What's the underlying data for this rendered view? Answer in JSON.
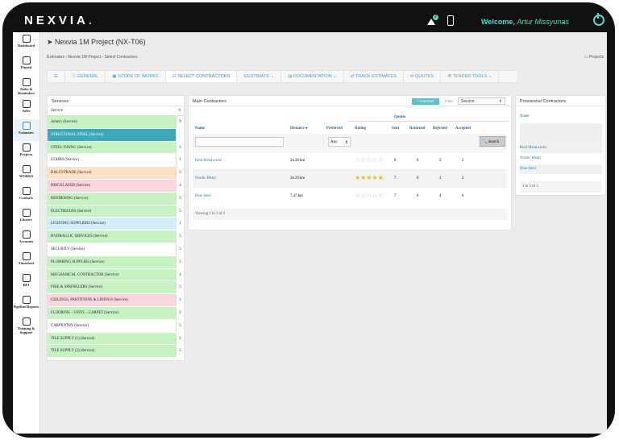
{
  "app": {
    "logo": "NEXVIA",
    "logo_suffix": ".",
    "welcome_prefix": "Welcome,",
    "user": "Artur Missyunas",
    "notif_count": "2"
  },
  "nav": [
    {
      "label": "Dashboard"
    },
    {
      "label": "Pinned"
    },
    {
      "label": "Tasks & Reminders"
    },
    {
      "label": "Sales"
    },
    {
      "label": "Estimates"
    },
    {
      "label": "Projects"
    },
    {
      "label": "WORKS"
    },
    {
      "label": "Contacts"
    },
    {
      "label": "Library"
    },
    {
      "label": "Accounts"
    },
    {
      "label": "Timesheet"
    },
    {
      "label": "RFI"
    },
    {
      "label": "Pipeline Reports"
    },
    {
      "label": "Training & Support"
    }
  ],
  "page": {
    "title": "Nexvia 1M Project (NX-T06)",
    "breadcrumb": [
      "Estimates",
      "Nexvia 1M Project",
      "Select Contractors"
    ],
    "projects_link": "Projects"
  },
  "tabs": [
    "GENERAL",
    "SCOPE OF WORKS",
    "SELECT CONTRACTORS",
    "ESTIMATE",
    "DOCUMENTATION",
    "TRACK ESTIMATES",
    "QUOTES",
    "TENDER TOOLS"
  ],
  "services": {
    "title": "Services",
    "col_header": "Service",
    "rows": [
      {
        "name": "Joinery (Service)",
        "count": "9",
        "color": "#c9f2c4"
      },
      {
        "name": "STRUCTURAL STEEL (Service)",
        "count": "3",
        "color": "#3fa8b4"
      },
      {
        "name": "STEEL FIXING (Service)",
        "count": "3",
        "color": "#c9f2c4"
      },
      {
        "name": "STAIRS (Service)",
        "count": "1",
        "color": "#ffffff"
      },
      {
        "name": "BALUSTRADE (Service)",
        "count": "3",
        "color": "#fde1c8"
      },
      {
        "name": "BRICKLAYER (Service)",
        "count": "4",
        "color": "#fbd6dc"
      },
      {
        "name": "RENDERING (Service)",
        "count": "3",
        "color": "#c9f2c4"
      },
      {
        "name": "ELECTRICIAN (Service)",
        "count": "5",
        "color": "#c9f2c4"
      },
      {
        "name": "LIGHTING SUPPLIERS (Service)",
        "count": "1",
        "color": "#d3eefa"
      },
      {
        "name": "HYDRAULIC SERVICES (Service)",
        "count": "3",
        "color": "#c9f2c4"
      },
      {
        "name": "SECURITY (Service)",
        "count": "5",
        "color": "#ffffff"
      },
      {
        "name": "PLUMBING SUPPLIES (Service)",
        "count": "3",
        "color": "#c9f2c4"
      },
      {
        "name": "MECHANICAL CONTRACTOR (Service)",
        "count": "4",
        "color": "#c9f2c4"
      },
      {
        "name": "FIRE & SPRINKLERS (Service)",
        "count": "5",
        "color": "#c9f2c4"
      },
      {
        "name": "CEILINGS, PARTITIONS & LININGS (Service)",
        "count": "3",
        "color": "#fbd6dc"
      },
      {
        "name": "FLOORING - VINYL - CARPET (Service)",
        "count": "3",
        "color": "#c9f2c4"
      },
      {
        "name": "CARPENTRY (Service)",
        "count": "5",
        "color": "#ffffff"
      },
      {
        "name": "TILE SUPPLY (1) (Service)",
        "count": "3",
        "color": "#c9f2c4"
      },
      {
        "name": "TILE SUPPLY (2) (Service)",
        "count": "3",
        "color": "#c9f2c4"
      }
    ]
  },
  "main": {
    "title": "Main Contractors",
    "contract_btn": "+ Contract",
    "filter_label": "Filter:",
    "filter_value": "Service",
    "quotes_group": "Quotes",
    "headers": {
      "name": "Name",
      "distance": "Distance",
      "preferred": "Preferred",
      "rating": "Rating",
      "sent": "Sent",
      "returned": "Returned",
      "rejected": "Rejected",
      "accepted": "Accepted"
    },
    "preferred_filter": "Any",
    "search_btn": "Search",
    "rows": [
      {
        "name": "Reid Metalworks",
        "distance": "24.28 km",
        "rating": 0,
        "sent": "6",
        "returned": "6",
        "rejected": "2",
        "accepted": "2"
      },
      {
        "name": "Nordic Metal",
        "distance": "34.29 km",
        "rating": 5,
        "sent": "7",
        "returned": "6",
        "rejected": "3",
        "accepted": "2"
      },
      {
        "name": "Blue Steel",
        "distance": "7.47 km",
        "rating": 0,
        "sent": "7",
        "returned": "6",
        "rejected": "4",
        "accepted": "0"
      }
    ],
    "footer": "Viewing 1 to 3 of 3"
  },
  "provisional": {
    "title": "Provisional Contractors",
    "col_header": "Name",
    "items": [
      "Reid Metalworks",
      "Nordic Metal",
      "Blue Steel"
    ],
    "footer": "1 to 3 of 3"
  }
}
